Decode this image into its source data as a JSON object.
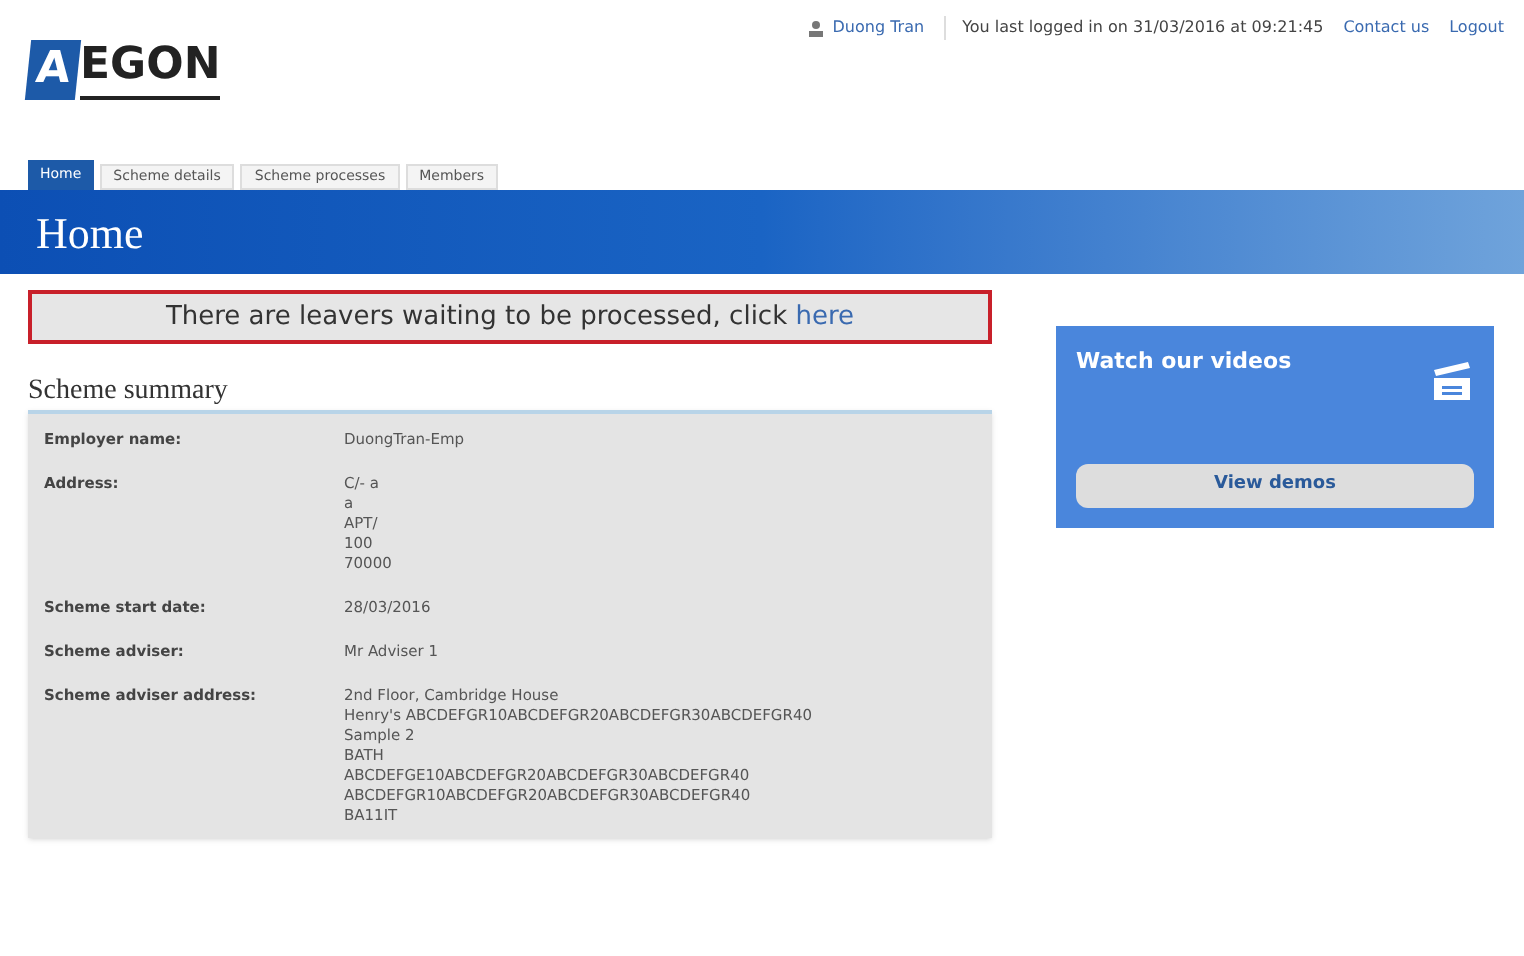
{
  "logo": {
    "mark": "A",
    "text": "EGON"
  },
  "user_bar": {
    "user": "Duong Tran",
    "last_login": "You last logged in on 31/03/2016 at 09:21:45",
    "links": [
      "Contact us",
      "Logout"
    ]
  },
  "tabs": [
    {
      "label": "Home",
      "selected": true
    },
    {
      "label": "Scheme details",
      "selected": false
    },
    {
      "label": "Scheme processes",
      "selected": false
    },
    {
      "label": "Members",
      "selected": false
    }
  ],
  "page_title": "Home",
  "alert": {
    "text": "There are leavers waiting to be processed, click",
    "link": "here"
  },
  "scheme_summary": {
    "title": "Scheme summary",
    "rows": [
      {
        "label": "Employer name:",
        "lines": [
          "DuongTran-Emp"
        ]
      },
      {
        "label": "Address:",
        "lines": [
          "C/- a",
          "a",
          "APT/",
          "100",
          "70000"
        ]
      },
      {
        "label": "Scheme start date:",
        "lines": [
          "28/03/2016"
        ]
      },
      {
        "label": "Scheme adviser:",
        "lines": [
          "Mr Adviser 1"
        ]
      },
      {
        "label": "Scheme adviser address:",
        "lines": [
          "2nd Floor, Cambridge House",
          "Henry's ABCDEFGR10ABCDEFGR20ABCDEFGR30ABCDEFGR40",
          "Sample 2",
          "BATH",
          "ABCDEFGE10ABCDEFGR20ABCDEFGR30ABCDEFGR40",
          "ABCDEFGR10ABCDEFGR20ABCDEFGR30ABCDEFGR40",
          "BA11IT"
        ]
      }
    ]
  },
  "videos": {
    "title": "Watch our videos",
    "button": "View demos"
  }
}
